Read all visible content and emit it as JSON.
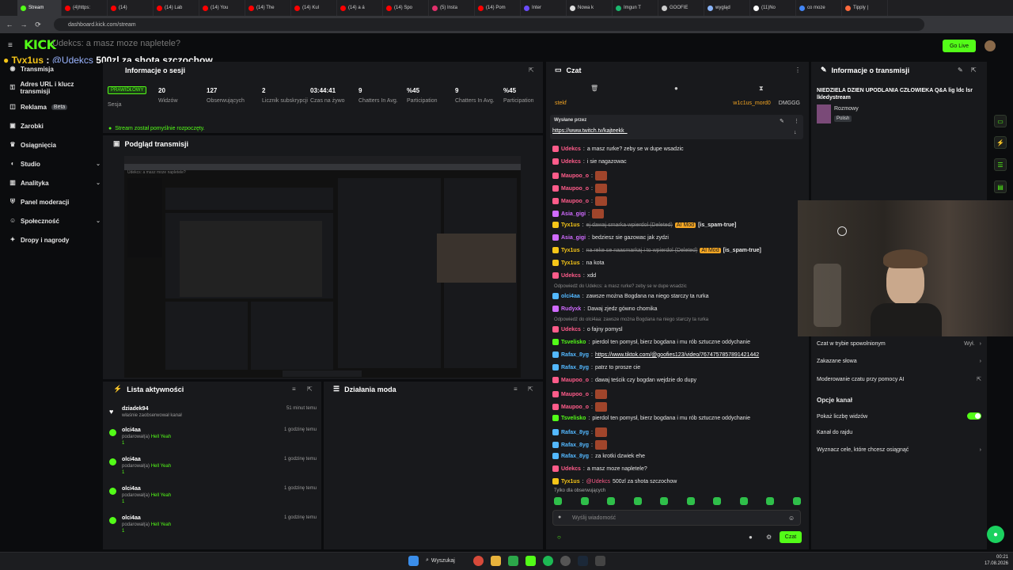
{
  "browser": {
    "tabs": [
      {
        "label": "Stream",
        "color": "#53fc18",
        "active": true
      },
      {
        "label": "(4)https:",
        "color": "#ff0000"
      },
      {
        "label": "(14)",
        "color": "#ff0000"
      },
      {
        "label": "(14) Lab",
        "color": "#ff0000"
      },
      {
        "label": "(14) You",
        "color": "#ff0000"
      },
      {
        "label": "(14) The",
        "color": "#ff0000"
      },
      {
        "label": "(14) Kul",
        "color": "#ff0000"
      },
      {
        "label": "(14) a á",
        "color": "#ff0000"
      },
      {
        "label": "(14) Spo",
        "color": "#ff0000"
      },
      {
        "label": "(5) Insta",
        "color": "#e1306c"
      },
      {
        "label": "(14) Pom",
        "color": "#ff0000"
      },
      {
        "label": "Inter",
        "color": "#6b4cff"
      },
      {
        "label": "Nowa k",
        "color": "#dddddd"
      },
      {
        "label": "Imgun T",
        "color": "#1bb76e"
      },
      {
        "label": "GOOFIE",
        "color": "#cccccc"
      },
      {
        "label": "wygląd",
        "color": "#8ab4f8"
      },
      {
        "label": "(11)No",
        "color": "#ffffff"
      },
      {
        "label": "co moze",
        "color": "#4285f4"
      },
      {
        "label": "Tipply |",
        "color": "#ff6a3d"
      }
    ],
    "url": "dashboard.kick.com/stream"
  },
  "topbar": {
    "logo": "KICK",
    "overlay_question": "Udekcs: a masz moze napletele?",
    "overlay_user": "Tyx1us",
    "overlay_mention": "@Udekcs",
    "overlay_text": "500zl za shota szczochow",
    "go_live": "Go Live"
  },
  "sidebar": {
    "items": [
      {
        "label": "Transmisja",
        "icon": "broadcast-icon"
      },
      {
        "label": "Adres URL i klucz transmisji",
        "icon": "key-icon"
      },
      {
        "label": "Reklama",
        "icon": "ad-icon",
        "badge": "Beta"
      },
      {
        "label": "Zarobki",
        "icon": "money-icon"
      },
      {
        "label": "Osiągnięcia",
        "icon": "trophy-icon"
      },
      {
        "label": "Studio",
        "icon": "studio-icon",
        "chevron": true
      },
      {
        "label": "Analityka",
        "icon": "chart-icon",
        "chevron": true
      },
      {
        "label": "Panel moderacji",
        "icon": "shield-icon"
      },
      {
        "label": "Społeczność",
        "icon": "people-icon",
        "chevron": true
      },
      {
        "label": "Dropy i nagrody",
        "icon": "gift-icon"
      }
    ]
  },
  "session": {
    "title": "Informacje o sesji",
    "status_badge": "PRAWIDŁOWY",
    "session_label": "Sesja",
    "stats": [
      {
        "value": "20",
        "label": "Widzów"
      },
      {
        "value": "127",
        "label": "Obserwujących"
      },
      {
        "value": "2",
        "label": "Licznik subskrypcji"
      },
      {
        "value": "03:44:41",
        "label": "Czas na żywo"
      },
      {
        "value": "9",
        "label": "Chatters In Avg."
      },
      {
        "value": "%45",
        "label": "Participation"
      },
      {
        "value": "9",
        "label": "Chatters In Avg."
      },
      {
        "value": "%45",
        "label": "Participation"
      }
    ],
    "started": "Stream został pomyślnie rozpoczęty."
  },
  "preview": {
    "title": "Podgląd transmisji"
  },
  "activity": {
    "title": "Lista aktywności",
    "items": [
      {
        "name": "dziadek94",
        "sub": "właśnie zaobserwował kanał",
        "time": "51 minut temu",
        "icon": "heart-icon"
      },
      {
        "name": "olci4aa",
        "sub": "podarował(a)",
        "gift": "Hell Yeah",
        "count": "1",
        "time": "1 godzinę temu"
      },
      {
        "name": "olci4aa",
        "sub": "podarował(a)",
        "gift": "Hell Yeah",
        "count": "1",
        "time": "1 godzinę temu"
      },
      {
        "name": "olci4aa",
        "sub": "podarował(a)",
        "gift": "Hell Yeah",
        "count": "1",
        "time": "1 godzinę temu"
      },
      {
        "name": "olci4aa",
        "sub": "podarował(a)",
        "gift": "Hell Yeah",
        "count": "1",
        "time": "1 godzinę temu"
      }
    ]
  },
  "mod": {
    "title": "Działania moda"
  },
  "chat": {
    "title": "Czat",
    "top_users": [
      "stekf",
      "w1c1us_mord0",
      "DMGGG"
    ],
    "pinned_by": "Wysłane przez",
    "pinned_link": "https://www.twitch.tv/kajteekk_",
    "messages": [
      {
        "user": "Udekcs",
        "color": "#ff5c8a",
        "text": "a masz rurke? zeby se w dupe wsadzic"
      },
      {
        "user": "Udekcs",
        "color": "#ff5c8a",
        "text": "i sie nagazowac"
      },
      {
        "user": "Maupoo_o",
        "color": "#ff5c8a",
        "emote": true
      },
      {
        "user": "Maupoo_o",
        "color": "#ff5c8a",
        "emote": true
      },
      {
        "user": "Maupoo_o",
        "color": "#ff5c8a",
        "emote": true
      },
      {
        "user": "Asia_gigi",
        "color": "#d06bff",
        "emote": true
      },
      {
        "user": "Tyx1us",
        "color": "#f5c518",
        "deleted": "ej dawaj smarka wpierdol (Deleted)",
        "tag": "AI Mod",
        "extra": "[is_spam-true]"
      },
      {
        "user": "Asia_gigi",
        "color": "#d06bff",
        "text": "bedziesz sie gazowac jak zydzi"
      },
      {
        "user": "Tyx1us",
        "color": "#f5c518",
        "deleted": "na reke se naasmarkaj i to wpierdol (Deleted)",
        "tag": "AI Mod",
        "extra": "[is_spam-true]"
      },
      {
        "user": "Tyx1us",
        "color": "#f5c518",
        "text": "na kota"
      },
      {
        "user": "Udekcs",
        "color": "#ff5c8a",
        "text": "xdd"
      },
      {
        "reply": "Odpowiedź do Udekcs: a masz rurke? zeby se w dupe wsadzic"
      },
      {
        "user": "olci4aa",
        "color": "#53b8ff",
        "text": "zawsze można Bogdana na niego starczy ta rurka"
      },
      {
        "user": "Rudyxk",
        "color": "#d06bff",
        "text": "Dawaj zjedz gówno chomika"
      },
      {
        "reply": "Odpowiedź do olci4aa: zawsze można Bogdana na niego starczy ta rurka"
      },
      {
        "user": "Udekcs",
        "color": "#ff5c8a",
        "text": "o fajny pomysl"
      },
      {
        "user": "Tsvelisko",
        "color": "#53fc18",
        "text": "pierdol ten pomysł, bierz bogdana i mu rób sztuczne oddychanie"
      },
      {
        "user": "Rafax_8yg",
        "color": "#53b8ff",
        "link": "https://www.tiktok.com/@goofies123/video/7674757857891421442"
      },
      {
        "user": "Rafax_8yg",
        "color": "#53b8ff",
        "text": "patrz to prosze cie"
      },
      {
        "user": "Maupoo_o",
        "color": "#ff5c8a",
        "text": "dawaj teścik czy bogdan wejdzie do dupy"
      },
      {
        "user": "Maupoo_o",
        "color": "#ff5c8a",
        "emote": true
      },
      {
        "user": "Maupoo_o",
        "color": "#ff5c8a",
        "emote": true
      },
      {
        "user": "Tsvelisko",
        "color": "#53fc18",
        "text": "pierdol ten pomysł, bierz bogdana i mu rób sztuczne oddychanie"
      },
      {
        "user": "Rafax_8yg",
        "color": "#53b8ff",
        "emote": true
      },
      {
        "user": "Rafax_8yg",
        "color": "#53b8ff",
        "emote": true
      },
      {
        "user": "Rafax_8yg",
        "color": "#53b8ff",
        "text": "za krotki dzwiek ehe"
      },
      {
        "user": "Udekcs",
        "color": "#ff5c8a",
        "text": "a masz moze napletele?"
      },
      {
        "user": "Tyx1us",
        "color": "#f5c518",
        "mention": "@Udekcs",
        "text": "500zl za shota szczochow"
      }
    ],
    "followers_only": "Tylko dla obserwujących",
    "placeholder": "Wyślij wiadomość",
    "send": "Czat"
  },
  "info": {
    "title": "Informacje o transmisji",
    "stream_title": "NIEDZIELA DZIEN UPODLANIA CZŁOWIEKA",
    "stream_title2": "Q&A lig ldc lsr lkledystream",
    "category": "Rozmowy",
    "language": "Polish",
    "slow_mode": "Czat w trybie spowolnionym",
    "slow_value": "Wył.",
    "banned_words": "Zakazane słowa",
    "ai_mod": "Moderowanie czatu przy pomocy AI",
    "channel_options": "Opcje kanał",
    "show_viewers": "Pokaż liczbę widzów",
    "raid": "Kanał do rajdu",
    "goals": "Wyznacz cele, które chcesz osiągnąć"
  },
  "taskbar": {
    "search": "Wyszukaj",
    "time": "00:21",
    "date": "17.08.2026"
  }
}
